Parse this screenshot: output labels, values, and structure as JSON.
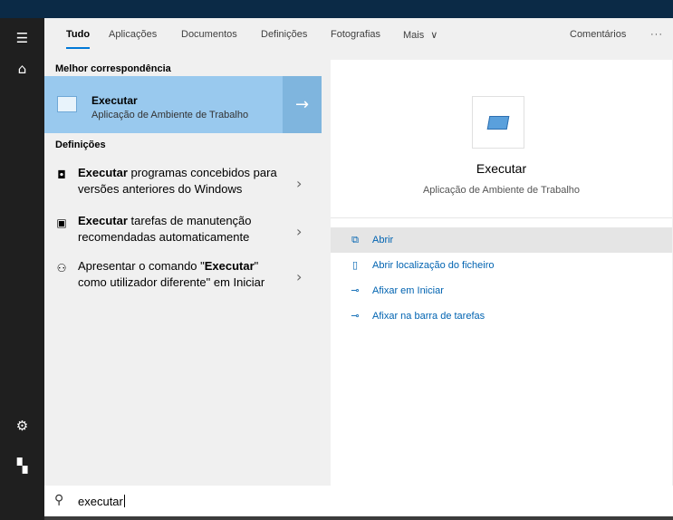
{
  "tabs": [
    {
      "label": "Tudo"
    },
    {
      "label": "Aplicações"
    },
    {
      "label": "Documentos"
    },
    {
      "label": "Definições"
    },
    {
      "label": "Fotografias"
    },
    {
      "label": "Mais"
    }
  ],
  "header": {
    "more_chevron": "∨",
    "feedback": "Comentários",
    "ellipsis": "···"
  },
  "sections": {
    "best_match": "Melhor correspondência",
    "settings": "Definições"
  },
  "best_match": {
    "title": "Executar",
    "subtitle": "Aplicação de Ambiente de Trabalho",
    "arrow": "→"
  },
  "results": [
    {
      "bold": "Executar",
      "rest": " programas concebidos para versões anteriores do Windows"
    },
    {
      "bold": "Executar",
      "rest": " tarefas de manutenção recomendadas automaticamente"
    },
    {
      "pre": "Apresentar o comando \"",
      "bold": "Executar",
      "rest": "\" como utilizador diferente\" em Iniciar"
    }
  ],
  "preview": {
    "title": "Executar",
    "subtitle": "Aplicação de Ambiente de Trabalho",
    "actions": [
      {
        "icon": "open-icon",
        "label": "Abrir"
      },
      {
        "icon": "file-location-icon",
        "label": "Abrir localização do ficheiro"
      },
      {
        "icon": "pin-icon",
        "label": "Afixar em Iniciar"
      },
      {
        "icon": "pin-icon",
        "label": "Afixar na barra de tarefas"
      }
    ]
  },
  "search": {
    "value": "executar"
  },
  "colors": {
    "accent": "#0078d7",
    "best_match_bg": "#99c9ee",
    "link": "#0063b1",
    "rail": "#1f1f1f"
  }
}
